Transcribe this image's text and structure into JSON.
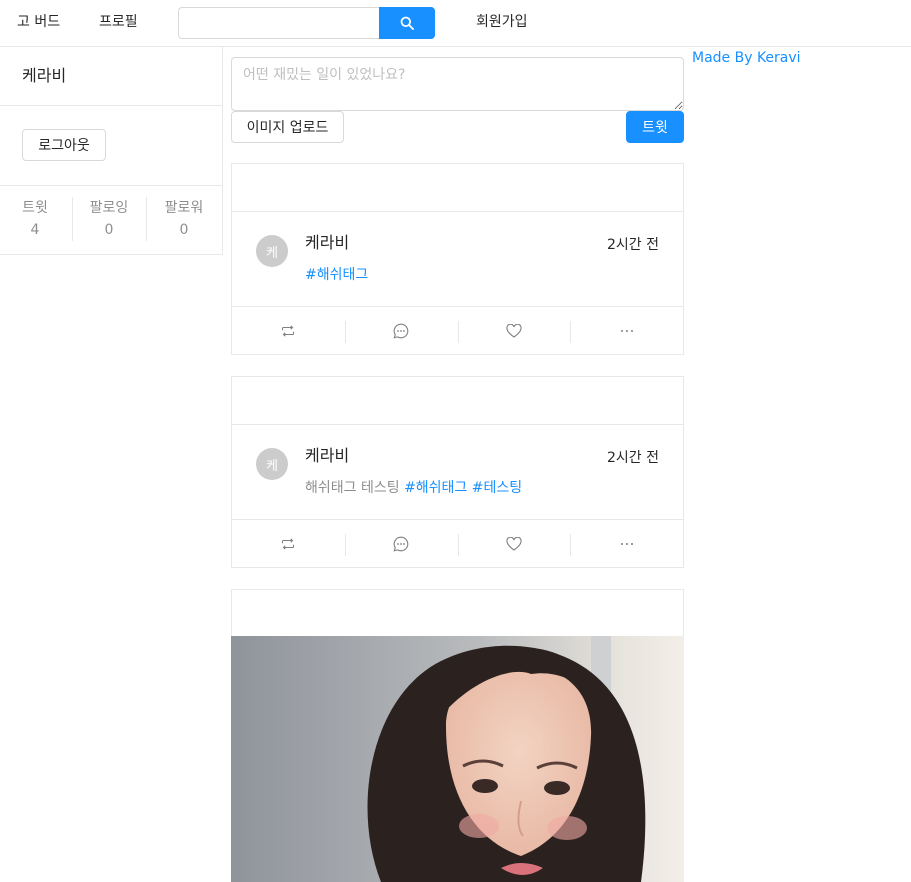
{
  "nav": {
    "home_label": "고 버드",
    "profile_label": "프로필",
    "search_placeholder": "",
    "signup_label": "회원가입"
  },
  "profile": {
    "name": "케라비",
    "logout_label": "로그아웃",
    "stats": [
      {
        "label": "트윗",
        "value": "4"
      },
      {
        "label": "팔로잉",
        "value": "0"
      },
      {
        "label": "팔로워",
        "value": "0"
      }
    ]
  },
  "compose": {
    "placeholder": "어떤 재밌는 일이 있었나요?",
    "upload_label": "이미지 업로드",
    "tweet_label": "트윗"
  },
  "sidebar_right": {
    "made_by": "Made By Keravi"
  },
  "posts": [
    {
      "avatar_letter": "케",
      "author": "케라비",
      "time": "2시간 전",
      "text": "",
      "tags": [
        "#해쉬태그"
      ]
    },
    {
      "avatar_letter": "케",
      "author": "케라비",
      "time": "2시간 전",
      "text": "해쉬태그 테스팅 ",
      "tags": [
        "#해쉬태그",
        "#테스팅"
      ]
    }
  ],
  "colors": {
    "accent": "#1890ff",
    "border": "#e8e8e8",
    "avatar_bg": "#cccccc"
  },
  "icons": [
    "search-icon",
    "retweet-icon",
    "comment-icon",
    "heart-icon",
    "ellipsis-icon"
  ]
}
